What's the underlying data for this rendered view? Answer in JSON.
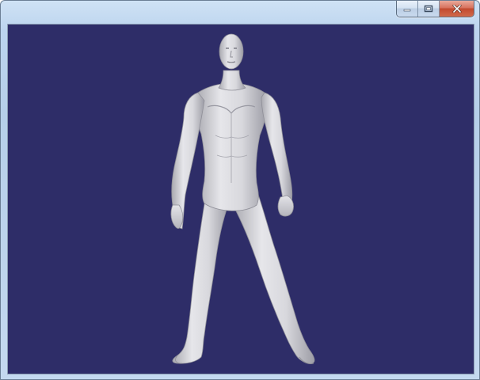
{
  "window": {
    "title": "",
    "controls": {
      "minimize_icon": "minimize-icon",
      "maximize_icon": "restore-icon",
      "close_icon": "close-icon"
    }
  },
  "viewport": {
    "background_color": "#2e2d68",
    "model_color": "#d8d8dc",
    "model": "human-figure-3d"
  }
}
